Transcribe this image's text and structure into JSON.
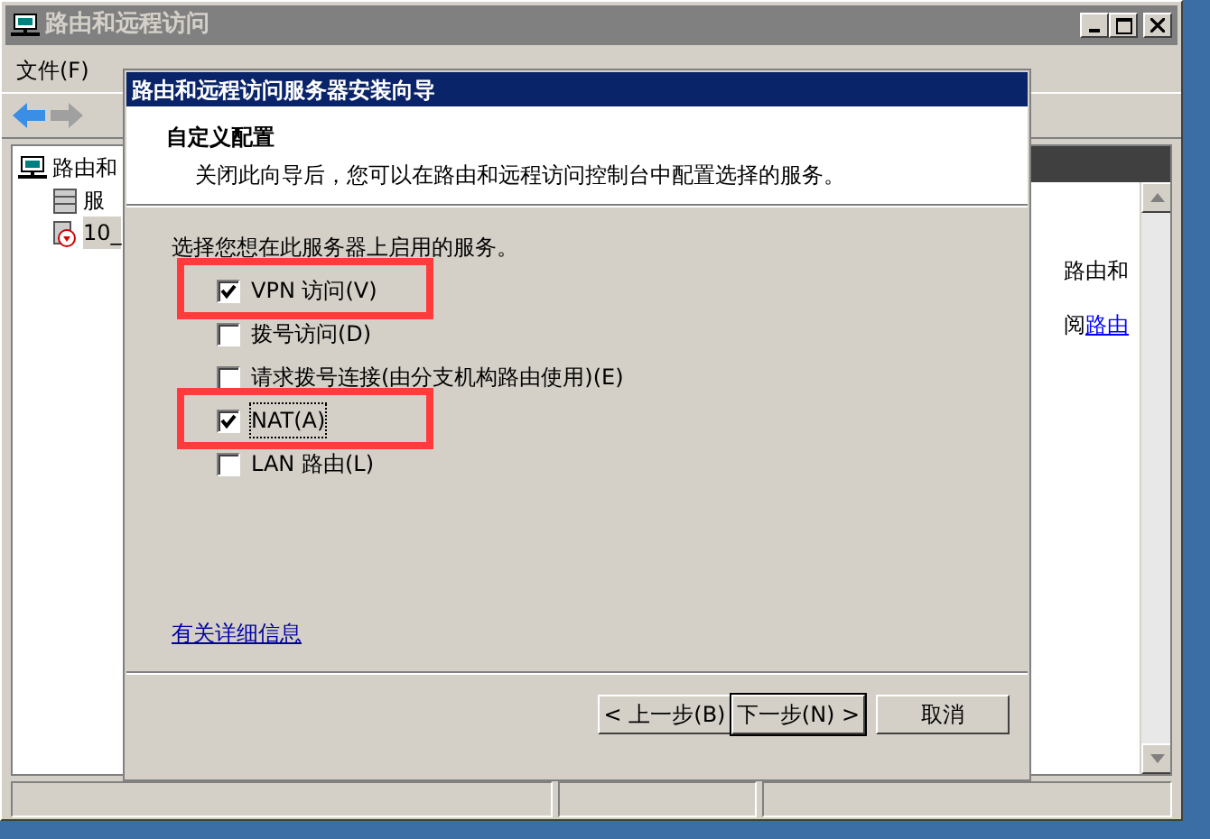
{
  "window": {
    "title": "路由和远程访问"
  },
  "menu": [
    {
      "label": "文件(F)"
    }
  ],
  "tree": [
    {
      "label": "路由和",
      "children": [
        {
          "label": "服",
          "selected": false
        },
        {
          "label": "10_",
          "selected": true
        }
      ]
    }
  ],
  "right_pane": {
    "line_1": "路由和",
    "line_2": "阅",
    "line_2_link": "路由"
  },
  "dialog": {
    "title": "路由和远程访问服务器安装向导",
    "heading": "自定义配置",
    "subtitle": "关闭此向导后，您可以在路由和远程访问控制台中配置选择的服务。",
    "prompt": "选择您想在此服务器上启用的服务。",
    "options": [
      {
        "label": "VPN 访问(V)",
        "checked": true,
        "focused": false,
        "highlighted": true
      },
      {
        "label": "拨号访问(D)",
        "checked": false,
        "focused": false,
        "highlighted": false
      },
      {
        "label": "请求拨号连接(由分支机构路由使用)(E)",
        "checked": false,
        "focused": false,
        "highlighted": false
      },
      {
        "label": "NAT(A)",
        "checked": true,
        "focused": true,
        "highlighted": true
      },
      {
        "label": "LAN 路由(L)",
        "checked": false,
        "focused": false,
        "highlighted": false
      }
    ],
    "link": "有关详细信息",
    "buttons": [
      {
        "label": "< 上一步(B)",
        "default": false
      },
      {
        "label": "下一步(N) >",
        "default": true
      },
      {
        "label": "取消",
        "default": false
      }
    ]
  }
}
